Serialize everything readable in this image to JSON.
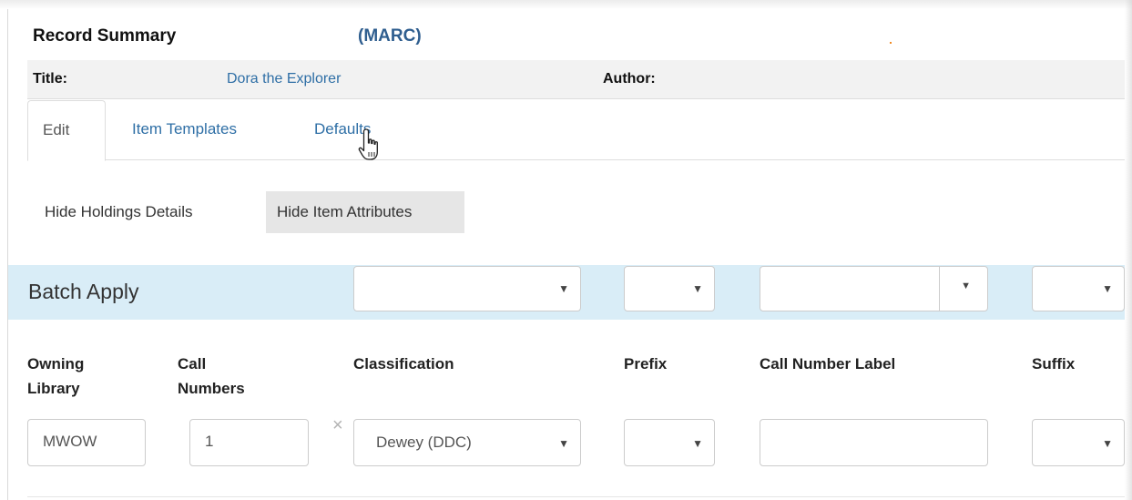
{
  "summary": {
    "heading": "Record Summary",
    "marc_link": "(MARC)",
    "title_label": "Title:",
    "title_value": "Dora the Explorer",
    "author_label": "Author:",
    "author_value": ""
  },
  "tabs": [
    {
      "label": "Edit",
      "active": true
    },
    {
      "label": "Item Templates",
      "active": false
    },
    {
      "label": "Defaults",
      "active": false
    }
  ],
  "toggles": {
    "hide_holdings": "Hide Holdings Details",
    "hide_item_attributes": "Hide Item Attributes"
  },
  "batch": {
    "title": "Batch Apply",
    "owning_library_value": "",
    "call_numbers_value": "",
    "classification_value": "",
    "prefix_value": "",
    "call_number_label_value": "",
    "suffix_value": ""
  },
  "columns": {
    "owning_library": [
      "Owning",
      "Library"
    ],
    "call_numbers": [
      "Call",
      "Numbers"
    ],
    "classification": "Classification",
    "prefix": "Prefix",
    "call_number_label": "Call Number Label",
    "suffix": "Suffix"
  },
  "row": {
    "owning_library": "MWOW",
    "call_numbers": "1",
    "classification": "Dewey (DDC)",
    "prefix": "",
    "call_number_label": "",
    "suffix": ""
  },
  "icons": {
    "caret": "▼",
    "clear": "×"
  },
  "colors": {
    "link": "#2f6fa6",
    "batch_bar": "#d9edf7",
    "pressed_button": "#e6e6e6"
  }
}
